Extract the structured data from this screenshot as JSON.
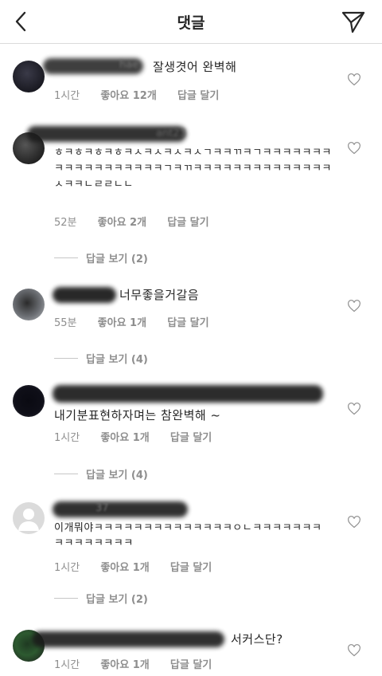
{
  "header": {
    "title": "댓글"
  },
  "comments": [
    {
      "partial_username": "hae",
      "text": "잘생겻어 완벽해",
      "time": "1시간",
      "likes": "좋아요 12개",
      "reply": "답글 달기"
    },
    {
      "partial_username": "ant23",
      "text": "ㅎㅋㅎㅋㅎㅋㅎㅋㅅㅋㅅㅋㅅㅋㅅㄱㅋㅋㄲㅋㄱㅋㅋㅋㅋㅋㅋㅋㅋㅋㅋㅋㅋㅋㅋㅋㅋㅋㅋㄱㅋㄲㅋㅋㅋㅋㅋㅋㅋㅋㅋㅋㅋㅋㅋㅋㅅㅋㅋㄴㄹㄹㄴㄴ",
      "time": "52분",
      "likes": "좋아요 2개",
      "reply": "답글 달기",
      "view_replies": "답글 보기 (2)"
    },
    {
      "text": "너무좋을거갈음",
      "time": "55분",
      "likes": "좋아요 1개",
      "reply": "답글 달기",
      "view_replies": "답글 보기 (4)"
    },
    {
      "text": "내기분표현하자며는 참완벽해 ~",
      "time": "1시간",
      "likes": "좋아요 1개",
      "reply": "답글 달기",
      "view_replies": "답글 보기 (4)"
    },
    {
      "partial_username": "37",
      "text": "이개뭐야ㅋㅋㅋㅋㅋㅋㅋㅋㅋㅋㅋㅋㅋㅋㅇㄴㅋㅋㅋㅋㅋㅋㅋㅋㅋㅋㅋㅋㅋㅋㅋ",
      "time": "1시간",
      "likes": "좋아요 1개",
      "reply": "답글 달기",
      "view_replies": "답글 보기 (2)"
    },
    {
      "text": "서커스단?",
      "time": "1시간",
      "likes": "좋아요 1개",
      "reply": "답글 달기"
    }
  ],
  "icons": {
    "back": "back-chevron-icon",
    "send": "direct-send-icon",
    "like": "heart-outline-icon",
    "default_avatar": "default-avatar-icon"
  }
}
